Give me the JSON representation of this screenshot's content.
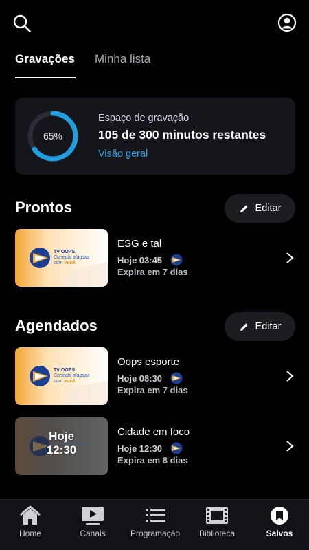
{
  "tabs": {
    "recordings": "Gravações",
    "my_list": "Minha lista"
  },
  "storage": {
    "percent_label": "65%",
    "used_fraction": 0.65,
    "title": "Espaço de gravação",
    "value": "105 de 300 minutos restantes",
    "link": "Visão geral"
  },
  "sections": {
    "ready": {
      "title": "Prontos",
      "edit": "Editar"
    },
    "scheduled": {
      "title": "Agendados",
      "edit": "Editar"
    }
  },
  "thumb_brand": {
    "name": "TV OOPS.",
    "tagline1": "Conecta alagoas",
    "tagline2": "com ",
    "tagline_accent": "você."
  },
  "items": [
    {
      "title": "ESG e tal",
      "time": "Hoje 03:45",
      "expires": "Expira em 7 dias"
    },
    {
      "title": "Oops esporte",
      "time": "Hoje 08:30",
      "expires": "Expira em 7 dias"
    },
    {
      "title": "Cidade em foco",
      "time": "Hoje 12:30",
      "expires": "Expira em 8 dias",
      "overlay_line1": "Hoje",
      "overlay_line2": "12:30"
    }
  ],
  "nav": [
    {
      "label": "Home",
      "icon": "home-icon"
    },
    {
      "label": "Canais",
      "icon": "tv-play-icon"
    },
    {
      "label": "Programação",
      "icon": "list-icon"
    },
    {
      "label": "Biblioteca",
      "icon": "film-icon"
    },
    {
      "label": "Salvos",
      "icon": "bookmark-icon",
      "active": true
    }
  ],
  "colors": {
    "accent": "#2aa3e3",
    "card": "#15151c",
    "background": "#000000"
  }
}
